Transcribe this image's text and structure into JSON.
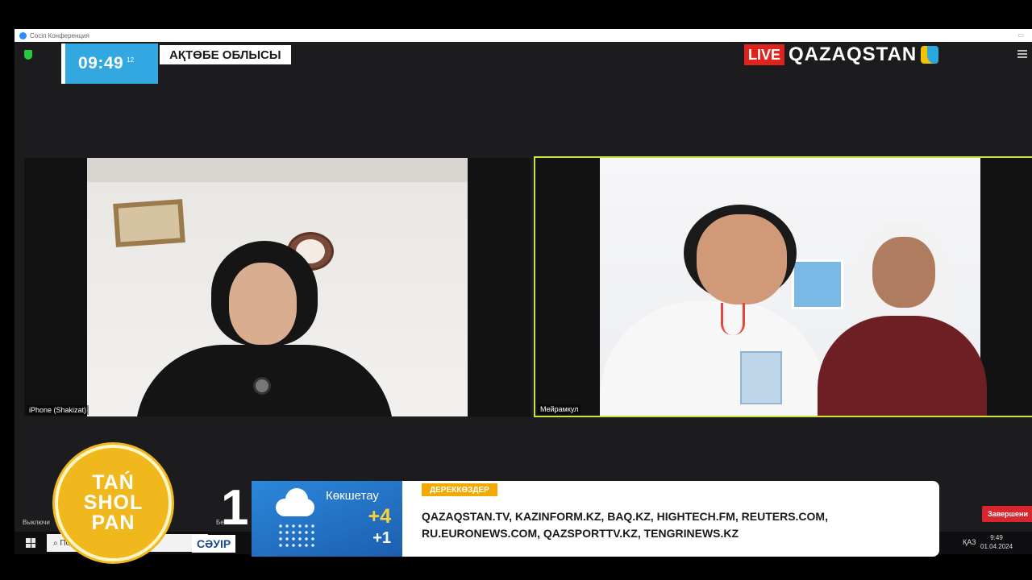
{
  "window": {
    "title": "Сосіп Конференция"
  },
  "participants": [
    {
      "name": "iPhone (Shakizat)"
    },
    {
      "name": "Мейрамкул"
    }
  ],
  "toolbar": {
    "mute_label": "Выключи",
    "video_label": "Без"
  },
  "end_button": {
    "label": "Завершени"
  },
  "taskbar": {
    "search_placeholder": "По",
    "language": "ҚАЗ",
    "time": "9:49",
    "date": "01.04.2024"
  },
  "broadcast": {
    "time": "09:49",
    "seconds": "12",
    "region": "АҚТӨБЕ ОБЛЫСЫ",
    "live_label": "LIVE",
    "channel": "QAZAQSTAN"
  },
  "show": {
    "line1": "TAŃ",
    "line2": "SHOL",
    "line3": "PAN"
  },
  "date_badge": {
    "day": "1",
    "month": "СӘУІР"
  },
  "weather": {
    "city": "Көкшетау",
    "day_temp": "+4",
    "night_temp": "+1",
    "icon": "rain-cloud-icon"
  },
  "sources": {
    "tag": "ДЕРЕККӨЗДЕР",
    "line1": "QAZAQSTAN.TV, KAZINFORM.KZ, BAQ.KZ, HIGHTECH.FM, REUTERS.COM,",
    "line2": "RU.EURONEWS.COM, QAZSPORTTV.KZ, TENGRINEWS.KZ"
  },
  "colors": {
    "live": "#e0231c",
    "clock_bg": "#33a8e0",
    "active_speaker": "#cfe23a",
    "show_logo": "#f0b81c",
    "sources_tag": "#f2a900"
  }
}
